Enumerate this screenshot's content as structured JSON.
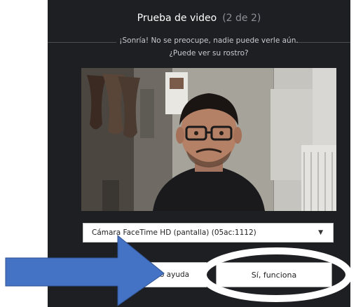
{
  "dialog": {
    "title": "Prueba de video",
    "step": "(2 de 2)",
    "subtitle_line1": "¡Sonría! No se preocupe, nadie puede verle aún.",
    "subtitle_line2": "¿Puede ver su rostro?"
  },
  "camera_select": {
    "selected": "Cámara FaceTime HD (pantalla) (05ac:1112)"
  },
  "buttons": {
    "help_label": "o ayuda",
    "yes_label": "Sí, funciona"
  },
  "colors": {
    "dialog_bg": "#1e1f22",
    "arrow": "#4472c4",
    "highlight_ring": "#ffffff"
  }
}
